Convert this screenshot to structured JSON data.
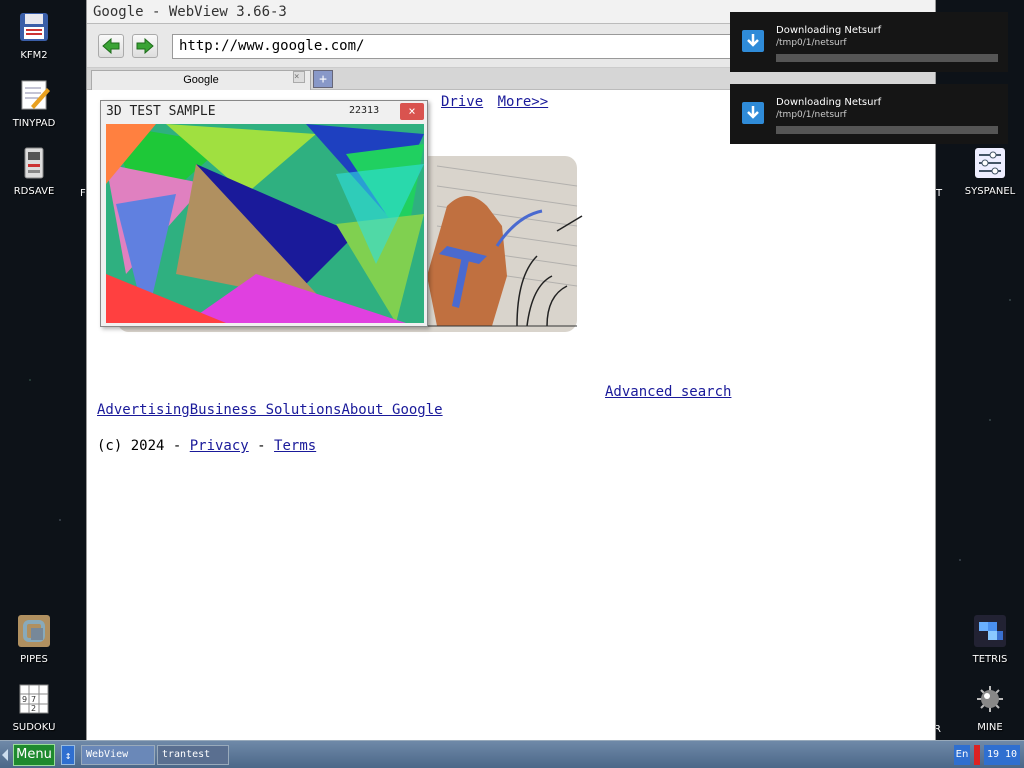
{
  "desktop": {
    "left_icons": [
      {
        "label": "KFM2",
        "icon": "floppy-disk-icon"
      },
      {
        "label": "TINYPAD",
        "icon": "notepad-icon"
      },
      {
        "label": "RDSAVE",
        "icon": "ramdisk-save-icon"
      },
      {
        "label": "PIPES",
        "icon": "pipes-game-icon"
      },
      {
        "label": "SUDOKU",
        "icon": "sudoku-icon"
      }
    ],
    "right_icons": [
      {
        "label": "SYSPANEL",
        "icon": "sliders-icon"
      },
      {
        "label": "TETRIS",
        "icon": "tetris-icon"
      },
      {
        "label": "MINE",
        "icon": "mine-icon"
      }
    ],
    "partial_labels": {
      "left_f": "F",
      "right_t": "T",
      "right_r": "R"
    }
  },
  "browser": {
    "title": "Google - WebView 3.66-3",
    "url": "http://www.google.com/",
    "tab_label": "Google",
    "tab_close": "×",
    "tab_add": "+",
    "page": {
      "nav_drive": "Drive",
      "nav_more": "More>>",
      "advanced_search": "Advanced search",
      "footer": {
        "advertising": "Advertising",
        "business": "Business Solutions",
        "about": "About Google"
      },
      "copyright_prefix": "(c) 2024 - ",
      "privacy": "Privacy",
      "sep": " - ",
      "terms": "Terms"
    }
  },
  "test_window": {
    "title": "3D TEST SAMPLE",
    "fps": "22313",
    "close": "×"
  },
  "notifications": [
    {
      "title": "Downloading Netsurf",
      "path": "/tmp0/1/netsurf",
      "progress": 0.0
    },
    {
      "title": "Downloading Netsurf",
      "path": "/tmp0/1/netsurf",
      "progress": 0.0
    }
  ],
  "taskbar": {
    "menu_label": "Menu",
    "swap_label": "↕",
    "tasks": [
      "WebView",
      "trantest"
    ],
    "lang": "En",
    "clock": "19 10"
  },
  "colors": {
    "accent_blue": "#2f6fd0",
    "menu_green": "#1e8a2e",
    "link": "#1a1a9a",
    "close_red": "#d9534f"
  }
}
